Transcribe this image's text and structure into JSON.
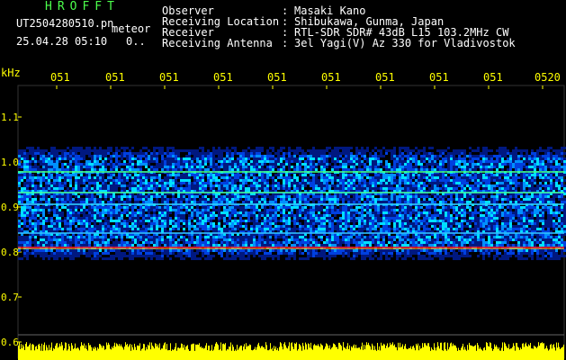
{
  "header": {
    "app_title": "HROFFT",
    "filename": "UT2504280510.pn",
    "meteor_tag": "meteor",
    "date_time": "25.04.28 05:10",
    "count": "0.."
  },
  "info": [
    {
      "label": "Observer",
      "value": "Masaki Kano"
    },
    {
      "label": "Receiving Location",
      "value": "Shibukawa, Gunma, Japan"
    },
    {
      "label": "Receiver",
      "value": "RTL-SDR SDR# 43dB L15 103.2MHz CW"
    },
    {
      "label": "Receiving Antenna",
      "value": "3el Yagi(V) Az 330 for Vladivostok"
    }
  ],
  "time_axis": {
    "labels": [
      "051",
      "051",
      "051",
      "051",
      "051",
      "051",
      "051",
      "051",
      "051",
      "0520"
    ]
  },
  "freq_axis": {
    "unit": "kHz",
    "labels": [
      "1.1",
      "1.0",
      "0.9",
      "0.8",
      "0.7",
      "0.6"
    ]
  },
  "colors": {
    "title": "#4cff4c",
    "text": "#ffffff",
    "axis": "#ffff00",
    "signal_line": "#ff2020",
    "noise_low": "#0020ff",
    "noise_high": "#00ffff"
  }
}
